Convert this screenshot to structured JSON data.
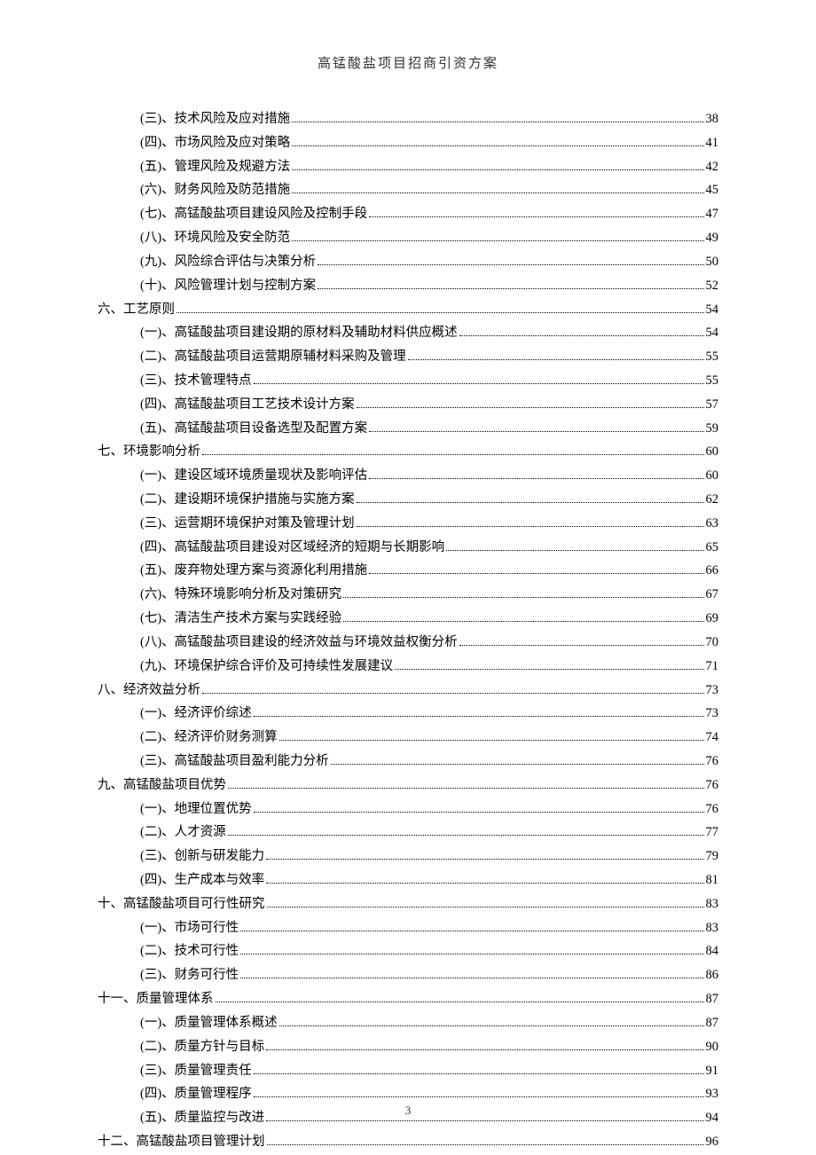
{
  "header": "高锰酸盐项目招商引资方案",
  "page_number": "3",
  "toc": [
    {
      "level": 2,
      "label": "(三)、技术风险及应对措施",
      "page": "38"
    },
    {
      "level": 2,
      "label": "(四)、市场风险及应对策略",
      "page": "41"
    },
    {
      "level": 2,
      "label": "(五)、管理风险及规避方法",
      "page": "42"
    },
    {
      "level": 2,
      "label": "(六)、财务风险及防范措施",
      "page": "45"
    },
    {
      "level": 2,
      "label": "(七)、高锰酸盐项目建设风险及控制手段",
      "page": "47"
    },
    {
      "level": 2,
      "label": "(八)、环境风险及安全防范",
      "page": "49"
    },
    {
      "level": 2,
      "label": "(九)、风险综合评估与决策分析",
      "page": "50"
    },
    {
      "level": 2,
      "label": "(十)、风险管理计划与控制方案",
      "page": "52"
    },
    {
      "level": 1,
      "label": "六、工艺原则",
      "page": "54"
    },
    {
      "level": 2,
      "label": "(一)、高锰酸盐项目建设期的原材料及辅助材料供应概述",
      "page": "54"
    },
    {
      "level": 2,
      "label": "(二)、高锰酸盐项目运营期原辅材料采购及管理",
      "page": "55"
    },
    {
      "level": 2,
      "label": "(三)、技术管理特点",
      "page": "55"
    },
    {
      "level": 2,
      "label": "(四)、高锰酸盐项目工艺技术设计方案",
      "page": "57"
    },
    {
      "level": 2,
      "label": "(五)、高锰酸盐项目设备选型及配置方案",
      "page": "59"
    },
    {
      "level": 1,
      "label": "七、环境影响分析",
      "page": "60"
    },
    {
      "level": 2,
      "label": "(一)、建设区域环境质量现状及影响评估",
      "page": "60"
    },
    {
      "level": 2,
      "label": "(二)、建设期环境保护措施与实施方案",
      "page": "62"
    },
    {
      "level": 2,
      "label": "(三)、运营期环境保护对策及管理计划",
      "page": "63"
    },
    {
      "level": 2,
      "label": "(四)、高锰酸盐项目建设对区域经济的短期与长期影响",
      "page": "65"
    },
    {
      "level": 2,
      "label": "(五)、废弃物处理方案与资源化利用措施",
      "page": "66"
    },
    {
      "level": 2,
      "label": "(六)、特殊环境影响分析及对策研究",
      "page": "67"
    },
    {
      "level": 2,
      "label": "(七)、清洁生产技术方案与实践经验",
      "page": "69"
    },
    {
      "level": 2,
      "label": "(八)、高锰酸盐项目建设的经济效益与环境效益权衡分析",
      "page": "70"
    },
    {
      "level": 2,
      "label": "(九)、环境保护综合评价及可持续性发展建议",
      "page": "71"
    },
    {
      "level": 1,
      "label": "八、经济效益分析",
      "page": "73"
    },
    {
      "level": 2,
      "label": "(一)、经济评价综述",
      "page": "73"
    },
    {
      "level": 2,
      "label": "(二)、经济评价财务测算",
      "page": "74"
    },
    {
      "level": 2,
      "label": "(三)、高锰酸盐项目盈利能力分析",
      "page": "76"
    },
    {
      "level": 1,
      "label": "九、高锰酸盐项目优势",
      "page": "76"
    },
    {
      "level": 2,
      "label": "(一)、地理位置优势",
      "page": "76"
    },
    {
      "level": 2,
      "label": "(二)、人才资源",
      "page": "77"
    },
    {
      "level": 2,
      "label": "(三)、创新与研发能力",
      "page": "79"
    },
    {
      "level": 2,
      "label": "(四)、生产成本与效率",
      "page": "81"
    },
    {
      "level": 1,
      "label": "十、高锰酸盐项目可行性研究",
      "page": "83"
    },
    {
      "level": 2,
      "label": "(一)、市场可行性",
      "page": "83"
    },
    {
      "level": 2,
      "label": "(二)、技术可行性",
      "page": "84"
    },
    {
      "level": 2,
      "label": "(三)、财务可行性",
      "page": "86"
    },
    {
      "level": 1,
      "label": "十一、质量管理体系",
      "page": "87"
    },
    {
      "level": 2,
      "label": "(一)、质量管理体系概述",
      "page": "87"
    },
    {
      "level": 2,
      "label": "(二)、质量方针与目标",
      "page": "90"
    },
    {
      "level": 2,
      "label": "(三)、质量管理责任",
      "page": "91"
    },
    {
      "level": 2,
      "label": "(四)、质量管理程序",
      "page": "93"
    },
    {
      "level": 2,
      "label": "(五)、质量监控与改进",
      "page": "94"
    },
    {
      "level": 1,
      "label": "十二、高锰酸盐项目管理计划",
      "page": "96"
    }
  ]
}
